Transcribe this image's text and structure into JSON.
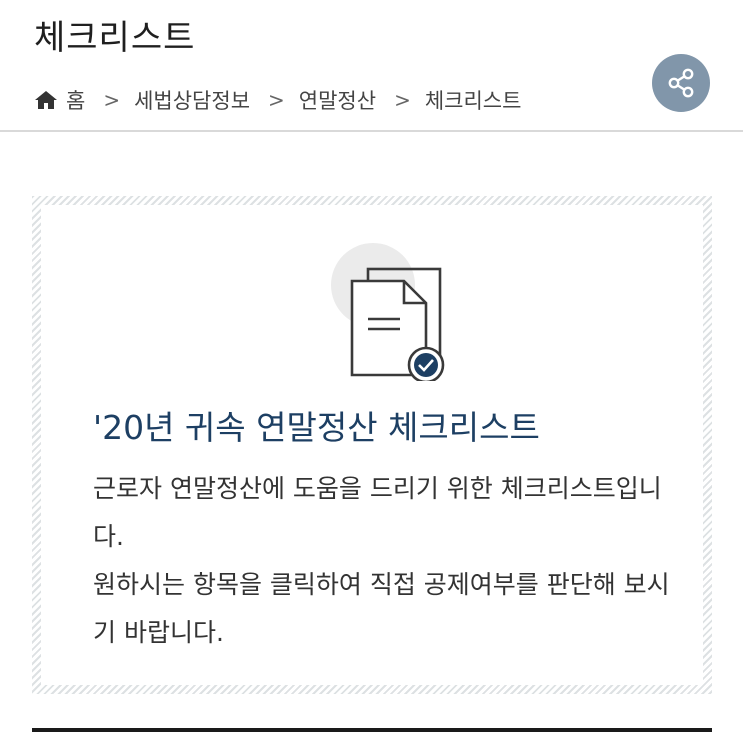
{
  "page": {
    "title": "체크리스트"
  },
  "breadcrumb": {
    "home_label": "홈",
    "items": [
      "세법상담정보",
      "연말정산",
      "체크리스트"
    ],
    "separator": ">"
  },
  "share": {
    "icon": "share-icon",
    "color": "#8196aa"
  },
  "card": {
    "icon": "document-check-icon",
    "title": "'20년 귀속 연말정산 체크리스트",
    "description_1": "근로자 연말정산에 도움을 드리기 위한 체크리스트입니다.",
    "description_2": "원하시는 항목을 클릭하여 직접 공제여부를 판단해 보시기 바랍니다.",
    "title_color": "#1d3f63"
  }
}
